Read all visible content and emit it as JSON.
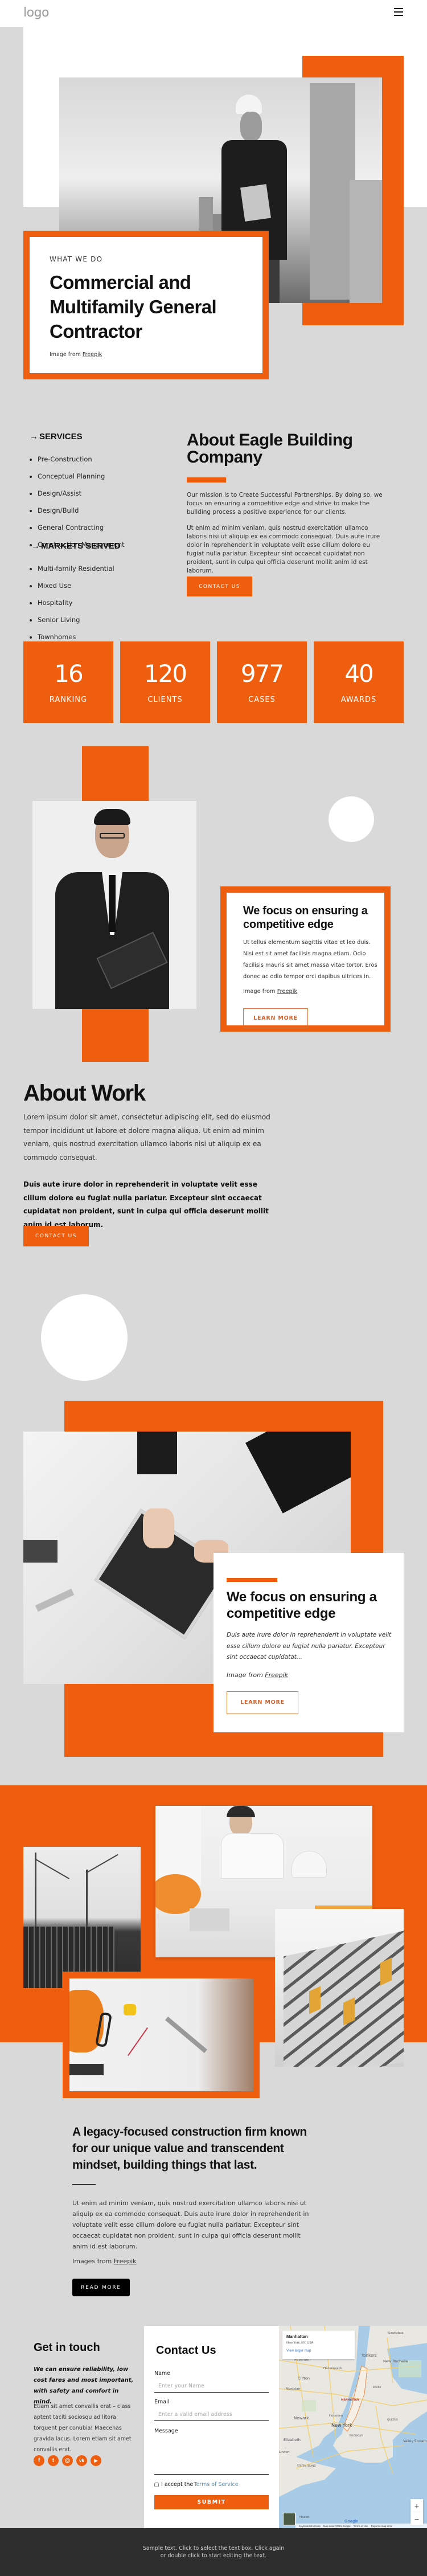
{
  "header": {
    "logo": "logo",
    "menu_icon": "hamburger-menu-icon"
  },
  "hero": {
    "eyebrow": "WHAT WE DO",
    "title": "Commercial and Multifamily General Contractor",
    "credit_prefix": "Image from ",
    "credit_link": "Freepik"
  },
  "services": {
    "title": "SERVICES",
    "items": [
      "Pre-Construction",
      "Conceptual Planning",
      "Design/Assist",
      "Design/Build",
      "General Contracting",
      "Construction Management"
    ]
  },
  "markets": {
    "title": "MARKETS SERVED",
    "items": [
      "Multi-family Residential",
      "Mixed Use",
      "Hospitality",
      "Senior Living",
      "Townhomes"
    ]
  },
  "about": {
    "title": "About Eagle Building Company",
    "p1": "Our mission is to Create Successful Partnerships. By doing so, we focus on ensuring a competitive edge and strive to make the building process a positive experience for our clients.",
    "p2": "Ut enim ad minim veniam, quis nostrud exercitation ullamco laboris nisi ut aliquip ex ea commodo consequat. Duis aute irure dolor in reprehenderit in voluptate velit esse cillum dolore eu fugiat nulla pariatur. Excepteur sint occaecat cupidatat non proident, sunt in culpa qui officia deserunt mollit anim id est laborum.",
    "button": "CONTACT US"
  },
  "stats": [
    {
      "value": "16",
      "label": "RANKING"
    },
    {
      "value": "120",
      "label": "CLIENTS"
    },
    {
      "value": "977",
      "label": "CASES"
    },
    {
      "value": "40",
      "label": "AWARDS"
    }
  ],
  "edge": {
    "title": "We focus on ensuring a competitive edge",
    "body": "Ut tellus elementum sagittis vitae et leo duis. Nisi est sit amet facilisis magna etiam. Odio facilisis mauris sit amet massa vitae tortor. Eros donec ac odio tempor orci dapibus ultrices in.",
    "credit_prefix": "Image from ",
    "credit_link": "Freepik",
    "button": "LEARN MORE"
  },
  "work": {
    "title": "About Work",
    "p1": "Lorem ipsum dolor sit amet, consectetur adipiscing elit, sed do eiusmod tempor incididunt ut labore et dolore magna aliqua. Ut enim ad minim veniam, quis nostrud exercitation ullamco laboris nisi ut aliquip ex ea commodo consequat.",
    "p2": "Duis aute irure dolor in reprehenderit in voluptate velit esse cillum dolore eu fugiat nulla pariatur. Excepteur sint occaecat cupidatat non proident, sunt in culpa qui officia deserunt mollit anim id est laborum.",
    "button": "CONTACT US"
  },
  "laptop": {
    "title": "We focus on ensuring a competitive edge",
    "body": "Duis aute irure dolor in reprehenderit in voluptate velit esse cillum dolore eu fugiat nulla pariatur. Excepteur sint occaecat cupidatat...",
    "credit_prefix": "Image from ",
    "credit_link": "Freepik",
    "button": "LEARN MORE"
  },
  "legacy": {
    "title": "A legacy-focused construction firm known for our unique value and transcendent mindset, building things that last.",
    "body": "Ut enim ad minim veniam, quis nostrud exercitation ullamco laboris nisi ut aliquip ex ea commodo consequat. Duis aute irure dolor in reprehenderit in voluptate velit esse cillum dolore eu fugiat nulla pariatur. Excepteur sint occaecat cupidatat non proident, sunt in culpa qui officia deserunt mollit anim id est laborum.",
    "credit_prefix": "Images from ",
    "credit_link": "Freepik",
    "button": "READ MORE"
  },
  "get_in_touch": {
    "title": "Get in touch",
    "tagline": "We can ensure reliability, low cost fares and most important, with safety and comfort in mind.",
    "body": "Etiam sit amet convallis erat – class aptent taciti sociosqu ad litora torquent per conubia! Maecenas gravida lacus. Lorem etiam sit amet convallis erat.",
    "socials": [
      {
        "name": "facebook-icon",
        "glyph": "f"
      },
      {
        "name": "twitter-icon",
        "glyph": "t"
      },
      {
        "name": "instagram-icon",
        "glyph": "◎"
      },
      {
        "name": "vk-icon",
        "glyph": "vk"
      },
      {
        "name": "youtube-icon",
        "glyph": "▶"
      }
    ]
  },
  "contact": {
    "title": "Contact Us",
    "name_label": "Name",
    "name_placeholder": "Enter your Name",
    "email_label": "Email",
    "email_placeholder": "Enter a valid email address",
    "message_label": "Message",
    "terms_prefix": "I accept the ",
    "terms_link": "Terms of Service",
    "submit": "SUBMIT"
  },
  "map": {
    "place": "Manhattan",
    "address": "New York, NY, USA",
    "larger_link": "View larger map",
    "labels": [
      "Yonkers",
      "New Rochelle",
      "Paterson",
      "Hackensack",
      "Clifton",
      "Montclair",
      "MANHATTAN",
      "Hoboken",
      "Newark",
      "New York",
      "QUEENS",
      "BROOKLYN",
      "Elizabeth",
      "Linden",
      "STATEN ISLAND",
      "Valley Stream",
      "Scarsdale",
      "Hazlet",
      "BRONX"
    ],
    "zoom_in": "+",
    "zoom_out": "−",
    "google": "Google",
    "attribution": [
      "Keyboard shortcuts",
      "Map data ©2021 Google",
      "Terms of Use",
      "Report a map error"
    ]
  },
  "footer": {
    "text": "Sample text. Click to select the text box. Click again or double click to start editing the text."
  },
  "colors": {
    "accent": "#ef5e0e",
    "background": "#d9d9d9",
    "footer": "#2e2e2e"
  }
}
